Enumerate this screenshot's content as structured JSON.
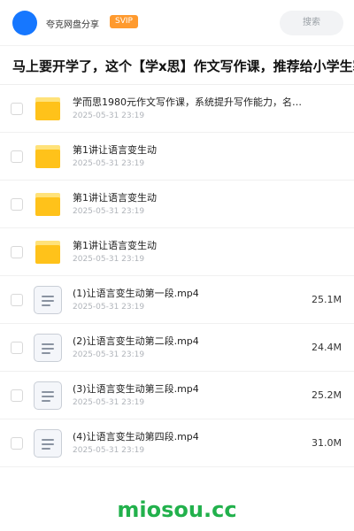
{
  "header": {
    "app_name": "夸克网盘分享",
    "badge": "SVIP",
    "search_placeholder": "搜索"
  },
  "share": {
    "title": "马上要开学了，这个【学x思】作文写作课，推荐给小学生寒假"
  },
  "items": [
    {
      "type": "folder",
      "name": "学而思1980元作文写作课，系统提升写作能力，名师…",
      "date": "2025-05-31 23:19",
      "size": ""
    },
    {
      "type": "folder",
      "name": "第1讲让语言变生动",
      "date": "2025-05-31 23:19",
      "size": ""
    },
    {
      "type": "folder",
      "name": "第1讲让语言变生动",
      "date": "2025-05-31 23:19",
      "size": ""
    },
    {
      "type": "folder",
      "name": "第1讲让语言变生动",
      "date": "2025-05-31 23:19",
      "size": ""
    },
    {
      "type": "file",
      "name": "(1)让语言变生动第一段.mp4",
      "date": "2025-05-31 23:19",
      "size": "25.1M"
    },
    {
      "type": "file",
      "name": "(2)让语言变生动第二段.mp4",
      "date": "2025-05-31 23:19",
      "size": "24.4M"
    },
    {
      "type": "file",
      "name": "(3)让语言变生动第三段.mp4",
      "date": "2025-05-31 23:19",
      "size": "25.2M"
    },
    {
      "type": "file",
      "name": "(4)让语言变生动第四段.mp4",
      "date": "2025-05-31 23:19",
      "size": "31.0M"
    }
  ],
  "footer": {
    "watermark": "miosou.cc"
  },
  "colors": {
    "accent": "#1677ff",
    "badge": "#ff9a2e",
    "folder": "#ffc21a",
    "watermark": "#22b14c"
  }
}
